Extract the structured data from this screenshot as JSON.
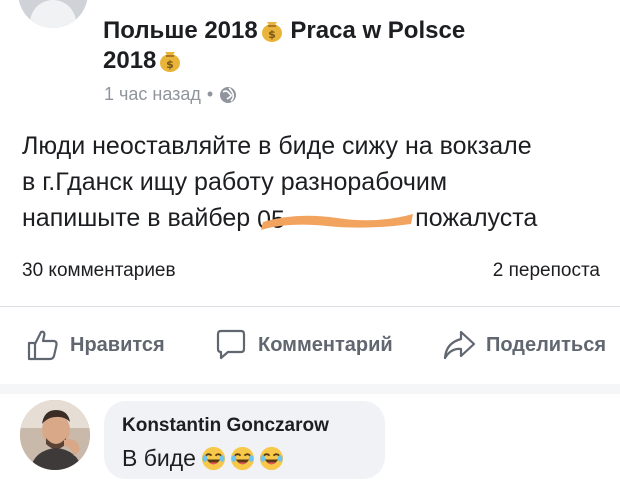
{
  "post": {
    "title_line1": "Польше 2018",
    "title_line2_prefix": "Praca w Polsce",
    "title_line3": "2018",
    "meta_time": "1 час назад",
    "meta_sep": "•",
    "text_line1": "Люди неоставляйте в биде сижу на вокзале",
    "text_line2": "в г.Гданск ищу работу разнорабочим",
    "text_line3_start": "напишыте в вайбер",
    "text_line3_hidden": "05",
    "text_line3_end": "пожалуста",
    "redaction_color": "#f2a35e"
  },
  "counts": {
    "comments": "30 комментариев",
    "shares": "2 перепоста"
  },
  "actions": {
    "like": "Нравится",
    "comment": "Комментарий",
    "share": "Поделиться"
  },
  "comment": {
    "author": "Konstantin Gonczarow",
    "text": "В биде"
  },
  "icons": [
    "money-bag-icon",
    "globe-icon",
    "thumbs-up-icon",
    "comment-icon",
    "share-icon",
    "laughing-emoji-icon"
  ],
  "colors": {
    "text": "#1c1e21",
    "muted": "#90949c",
    "action": "#606770",
    "bubble": "#f0f2f5"
  }
}
